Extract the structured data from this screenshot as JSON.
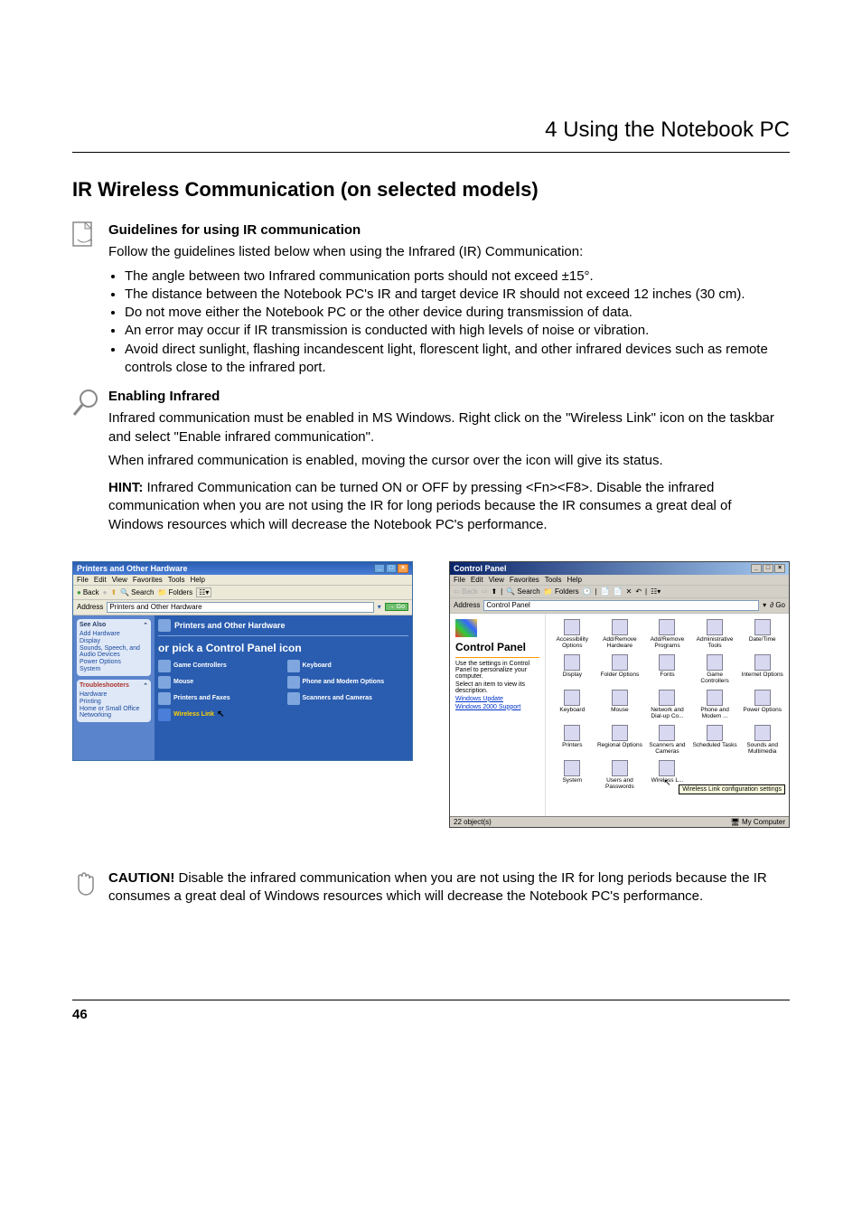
{
  "page": {
    "header": "4    Using the Notebook PC",
    "subHeader": "IR Wireless Communication (on selected models)",
    "footerPage": "46"
  },
  "guidelines": {
    "title": "Guidelines for using IR communication",
    "intro": "Follow the guidelines listed below when using the Infrared (IR) Communication:",
    "bullets": [
      "The angle between two Infrared communication ports should not exceed ±15°.",
      "The distance between the Notebook PC's IR and target device IR should not exceed 12 inches (30 cm).",
      "Do not move either the Notebook PC or the other device during transmission of data.",
      "An error may occur if IR transmission is conducted with high levels of noise or vibration.",
      "Avoid direct sunlight, flashing incandescent light, florescent light, and other infrared devices such as remote controls close to the infrared port."
    ]
  },
  "enabling": {
    "title": "Enabling Infrared",
    "body": "Infrared communication must be enabled in MS Windows. Right click on the \"Wireless Link\" icon on the taskbar and select \"Enable infrared communication\".",
    "body2": "When infrared communication is enabled, moving the cursor over the icon will give its status.",
    "hintTitle": "HINT:",
    "hintBody": "Infrared Communication can be turned ON or OFF by pressing <Fn><F8>. Disable the infrared communication when you are not using the IR for long periods because the IR consumes a great deal of Windows resources which will decrease the Notebook PC's performance."
  },
  "caution": {
    "title": "CAUTION!",
    "body": "Disable the infrared communication when you are not using the IR for long periods because the IR consumes a great deal of Windows resources which will decrease the Notebook PC's performance."
  },
  "shotLeft": {
    "title": "Printers and Other Hardware",
    "menu": [
      "File",
      "Edit",
      "View",
      "Favorites",
      "Tools",
      "Help"
    ],
    "toolbar": {
      "back": "Back",
      "search": "Search",
      "folders": "Folders"
    },
    "addressLabel": "Address",
    "addressValue": "Printers and Other Hardware",
    "go": "Go",
    "seeAlso": {
      "head": "See Also",
      "items": [
        "Add Hardware",
        "Display",
        "Sounds, Speech, and Audio Devices",
        "Power Options",
        "System"
      ]
    },
    "trouble": {
      "head": "Troubleshooters",
      "items": [
        "Hardware",
        "Printing",
        "Home or Small Office Networking"
      ]
    },
    "catTitle": "Printers and Other Hardware",
    "pick": "or pick a Control Panel icon",
    "row1": [
      "Game Controllers",
      "Keyboard"
    ],
    "row2": [
      "Mouse",
      "Phone and Modem Options"
    ],
    "row3": [
      "Printers and Faxes",
      "Scanners and Cameras"
    ],
    "wireless": "Wireless Link"
  },
  "shotRight": {
    "title": "Control Panel",
    "menu": [
      "File",
      "Edit",
      "View",
      "Favorites",
      "Tools",
      "Help"
    ],
    "toolbar": {
      "back": "Back",
      "search": "Search",
      "folders": "Folders"
    },
    "addressLabel": "Address",
    "addressValue": "Control Panel",
    "go": "Go",
    "side": {
      "title": "Control Panel",
      "desc1": "Use the settings in Control Panel to personalize your computer.",
      "desc2": "Select an item to view its description.",
      "link1": "Windows Update",
      "link2": "Windows 2000 Support"
    },
    "items": [
      "Accessibility Options",
      "Add/Remove Hardware",
      "Add/Remove Programs",
      "Administrative Tools",
      "Date/Time",
      "Display",
      "Folder Options",
      "Fonts",
      "Game Controllers",
      "Internet Options",
      "Keyboard",
      "Mouse",
      "Network and Dial-up Co...",
      "Phone and Modem ...",
      "Power Options",
      "Printers",
      "Regional Options",
      "Scanners and Cameras",
      "Scheduled Tasks",
      "Sounds and Multimedia",
      "System",
      "Users and Passwords",
      "Wireless L..."
    ],
    "tooltip": "Wireless Link configuration settings",
    "statusLeft": "22 object(s)",
    "statusRight": "My Computer"
  }
}
